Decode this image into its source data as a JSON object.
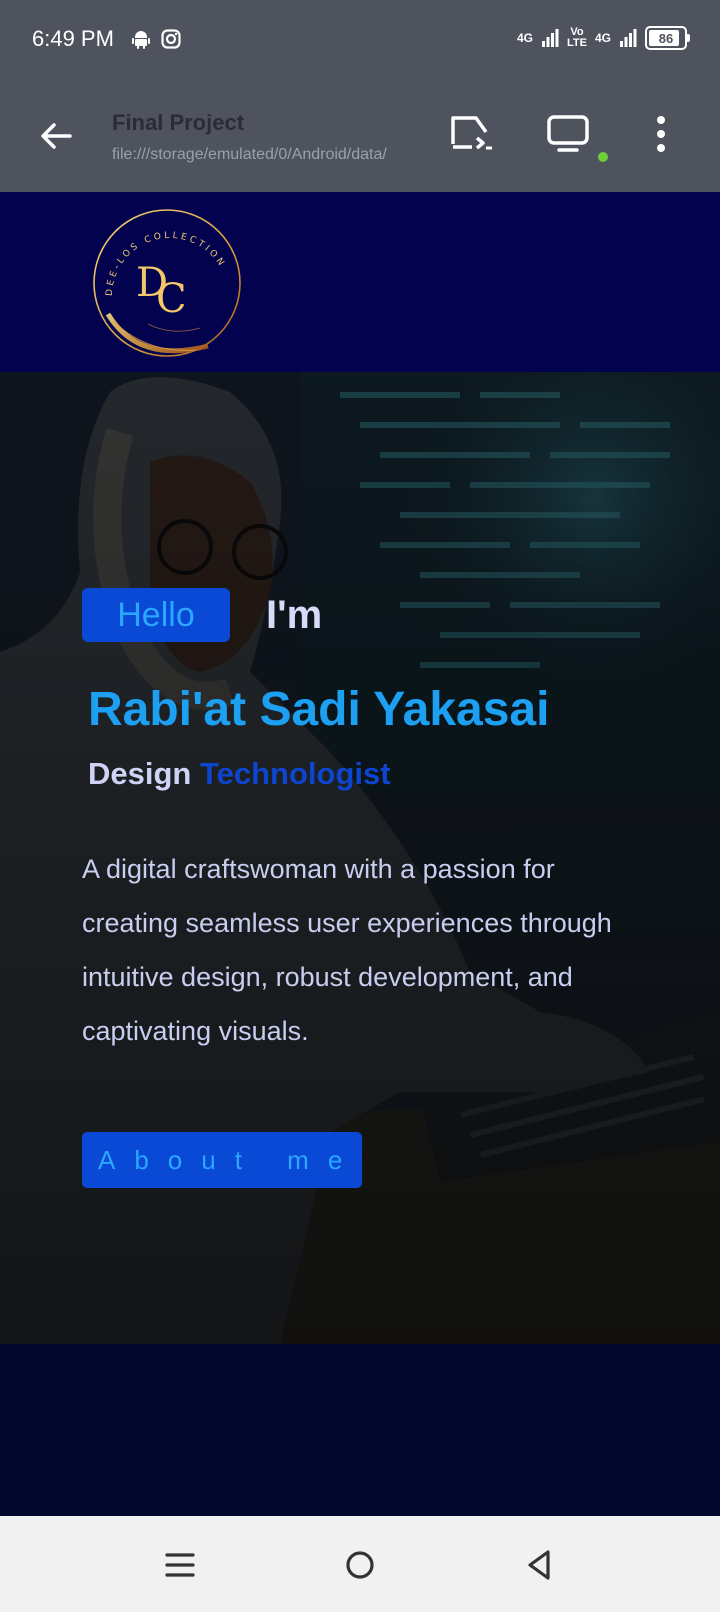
{
  "status_bar": {
    "time": "6:49 PM",
    "icons": [
      "android-icon",
      "instagram-icon"
    ],
    "network_1": "4G",
    "volte_top": "Vo",
    "volte_bottom": "LTE",
    "network_2": "4G",
    "battery": "86"
  },
  "app_bar": {
    "title": "Final Project",
    "url": "file:///storage/emulated/0/Android/data/",
    "icons": [
      "back-arrow-icon",
      "cast-icon",
      "desktop-icon",
      "more-vert-icon"
    ]
  },
  "site": {
    "logo": {
      "initials_1": "D",
      "initials_2": "C",
      "ring_text": "DEE-LOS COLLECTION"
    }
  },
  "hero": {
    "hello": "Hello",
    "im": "I'm",
    "name": "Rabi'at Sadi Yakasai",
    "role_part1": "Design",
    "role_part2": "Technologist",
    "bio": "A digital craftswoman with a passion for creating seamless user experiences through intuitive design, robust development, and captivating visuals.",
    "button": "About me"
  },
  "nav_bar": {
    "icons": [
      "recents-icon",
      "home-icon",
      "back-triangle-icon"
    ]
  },
  "colors": {
    "header_bg": "#02024f",
    "accent_blue": "#0a48d6",
    "light_blue": "#1da0f2",
    "page_bg": "#02072e",
    "system_bar": "#4f535e"
  }
}
